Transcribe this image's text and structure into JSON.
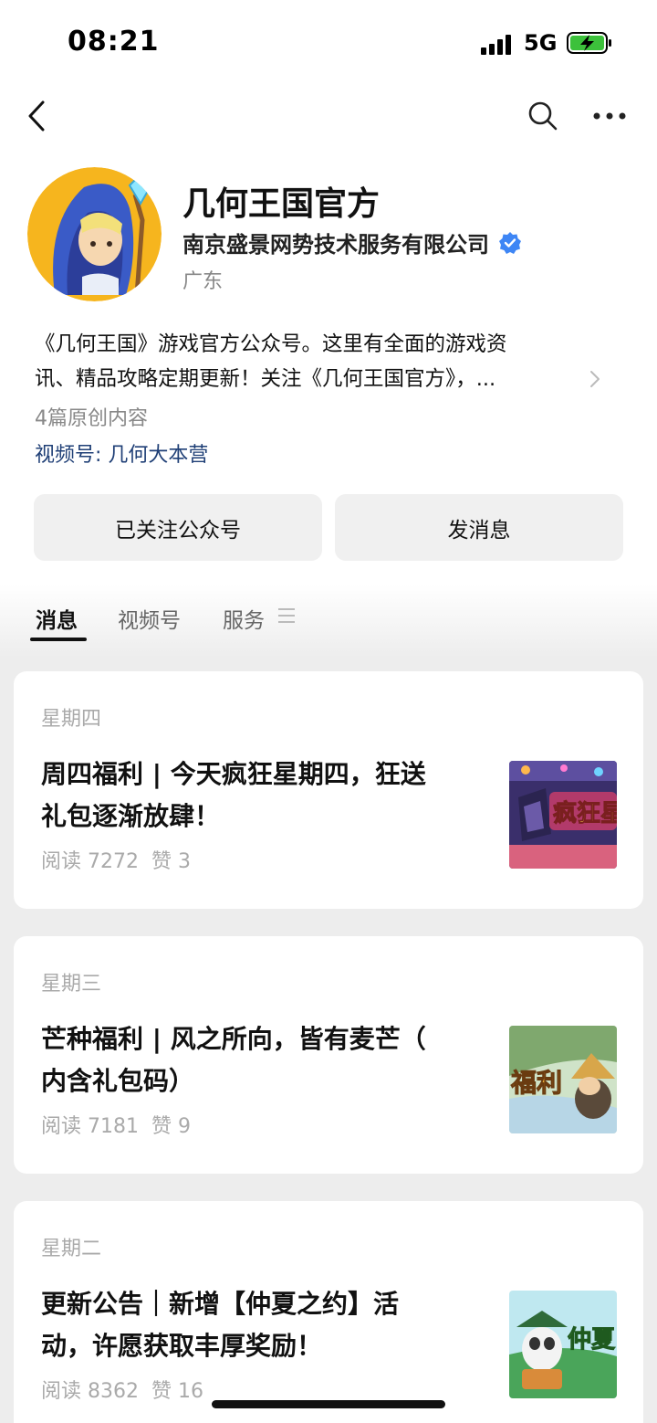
{
  "status_bar": {
    "time": "08:21",
    "network": "5G"
  },
  "account": {
    "name": "几何王国官方",
    "company": "南京盛景网势技术服务有限公司",
    "region": "广东",
    "description_line1": "《几何王国》游戏官方公众号。这里有全面的游戏资",
    "description_line2": "讯、精品攻略定期更新！关注《几何王国官方》，...",
    "original_count": "4篇原创内容",
    "channels": "视频号: 几何大本营"
  },
  "actions": {
    "follow_label": "已关注公众号",
    "message_label": "发消息"
  },
  "tabs": [
    {
      "label": "消息",
      "active": true
    },
    {
      "label": "视频号",
      "active": false
    },
    {
      "label": "服务",
      "active": false
    }
  ],
  "articles": [
    {
      "day": "星期四",
      "title_line1": "周四福利 | 今天疯狂星期四，狂送",
      "title_line2": "礼包逐渐放肆！",
      "reads": "阅读 7272",
      "likes": "赞 3",
      "thumb_text": "疯狂星"
    },
    {
      "day": "星期三",
      "title_line1": "芒种福利 | 风之所向，皆有麦芒（",
      "title_line2": "内含礼包码）",
      "reads": "阅读 7181",
      "likes": "赞 9",
      "thumb_text": "福利"
    },
    {
      "day": "星期二",
      "title_line1": "更新公告｜新增【仲夏之约】活",
      "title_line2": "动，许愿获取丰厚奖励！",
      "reads": "阅读 8362",
      "likes": "赞 16",
      "thumb_text": "仲夏"
    }
  ],
  "colors": {
    "verified": "#3e86f5",
    "link": "#1f3f76",
    "battery": "#3cc13b"
  }
}
